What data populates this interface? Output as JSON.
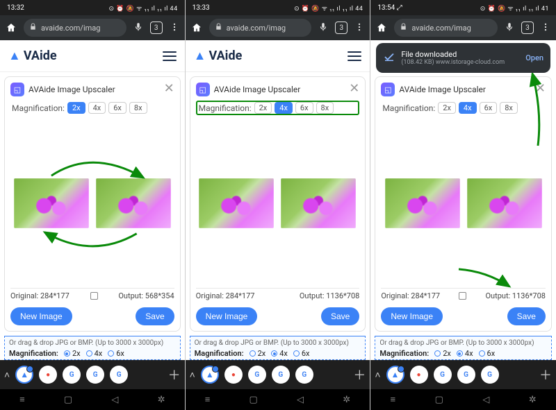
{
  "screens": [
    {
      "status": {
        "time": "13:32",
        "icons": "⊙ ⏰ 🔕 ᯤ ₁₁ ıl ₁₁ ıl 44"
      },
      "browser": {
        "url": "avaide.com/imag",
        "tabs": "3"
      },
      "site": {
        "brand": "VAide"
      },
      "card": {
        "title": "AVAide Image Upscaler",
        "mag_label": "Magnification:",
        "mag_options": [
          "2x",
          "4x",
          "6x",
          "8x"
        ],
        "mag_active": "2x",
        "mag_highlight": false,
        "show_swap_arrows": true,
        "original_label": "Original:",
        "original_value": "284*177",
        "output_label": "Output:",
        "output_value": "568*354",
        "show_io_checkbox": true,
        "new_image_label": "New Image",
        "save_label": "Save",
        "show_save_arrow": false
      },
      "below": {
        "hint": "Or drag & drop JPG or BMP. (Up to 3000 x 3000px)",
        "mag_label": "Magnification:",
        "options": [
          "2x",
          "4x",
          "6x"
        ],
        "active": "2x"
      }
    },
    {
      "status": {
        "time": "13:33",
        "icons": "⊙ ⏰ 🔕 ᯤ ₁₁ ıl ₁₁ ıl 44"
      },
      "browser": {
        "url": "avaide.com/imag",
        "tabs": "3"
      },
      "site": {
        "brand": "VAide"
      },
      "card": {
        "title": "AVAide Image Upscaler",
        "mag_label": "Magnification:",
        "mag_options": [
          "2x",
          "4x",
          "6x",
          "8x"
        ],
        "mag_active": "4x",
        "mag_highlight": true,
        "show_swap_arrows": false,
        "original_label": "Original:",
        "original_value": "284*177",
        "output_label": "Output:",
        "output_value": "1136*708",
        "show_io_checkbox": false,
        "new_image_label": "New Image",
        "save_label": "Save",
        "show_save_arrow": false
      },
      "below": {
        "hint": "Or drag & drop JPG or BMP. (Up to 3000 x 3000px)",
        "mag_label": "Magnification:",
        "options": [
          "2x",
          "4x",
          "6x"
        ],
        "active": "4x"
      }
    },
    {
      "status": {
        "time": "13:54",
        "icons": "⊙ ⏰ 🔕 ᯤ ₁₁ ıl ₁₁ ıl 41",
        "show_expand": true
      },
      "browser": {
        "url": "avaide.com/imag",
        "tabs": "3"
      },
      "snackbar": {
        "title": "File downloaded",
        "sub": "(108.42 KB) www.istorage-cloud.com",
        "open": "Open"
      },
      "card": {
        "title": "AVAide Image Upscaler",
        "mag_label": "Magnification:",
        "mag_options": [
          "2x",
          "4x",
          "6x",
          "8x"
        ],
        "mag_active": "4x",
        "mag_highlight": false,
        "show_swap_arrows": false,
        "original_label": "Original:",
        "original_value": "284*177",
        "output_label": "Output:",
        "output_value": "1136*708",
        "show_io_checkbox": true,
        "new_image_label": "New Image",
        "save_label": "Save",
        "show_save_arrow": true
      },
      "below": {
        "hint": "Or drag & drop JPG or BMP. (Up to 3000 x 3000px)",
        "mag_label": "Magnification:",
        "options": [
          "2x",
          "4x",
          "6x"
        ],
        "active": "4x"
      }
    }
  ]
}
